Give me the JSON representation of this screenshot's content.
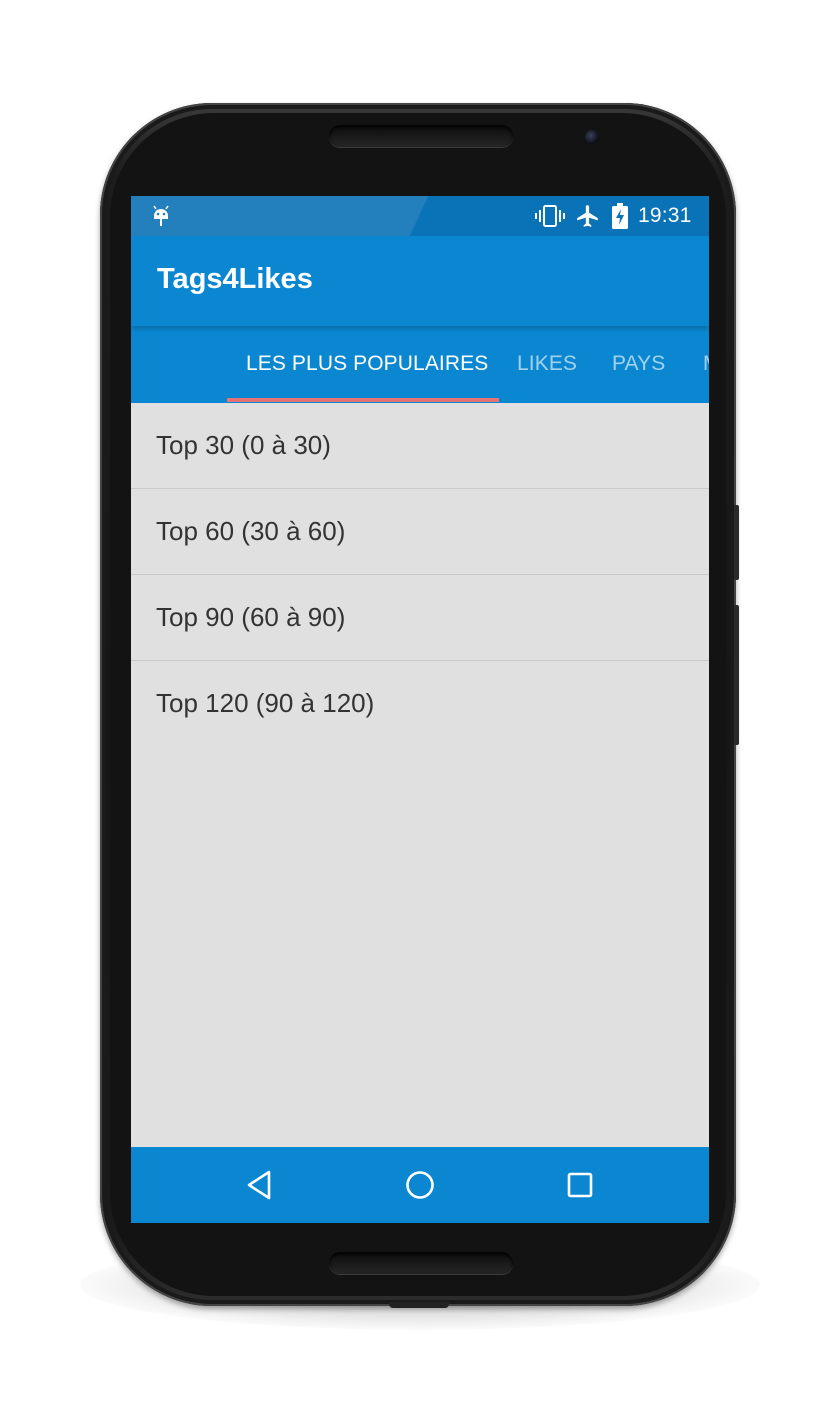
{
  "status_bar": {
    "time": "19:31",
    "icons": [
      "android-icon",
      "vibrate-icon",
      "airplane-mode-icon",
      "battery-charging-icon"
    ]
  },
  "app_bar": {
    "title": "Tags4Likes",
    "color": "#0a87d0"
  },
  "tabs": [
    {
      "label": "LES PLUS POPULAIRES",
      "active": true
    },
    {
      "label": "LIKES",
      "active": false
    },
    {
      "label": "PAYS",
      "active": false
    },
    {
      "label": "M",
      "active": false
    }
  ],
  "tab_indicator_color": "#e57373",
  "list": {
    "items": [
      {
        "label": "Top 30 (0 à 30)"
      },
      {
        "label": "Top 60 (30 à 60)"
      },
      {
        "label": "Top 90 (60 à 90)"
      },
      {
        "label": "Top 120 (90 à 120)"
      }
    ]
  },
  "nav_bar": {
    "buttons": [
      "back-icon",
      "home-icon",
      "recent-apps-icon"
    ]
  }
}
